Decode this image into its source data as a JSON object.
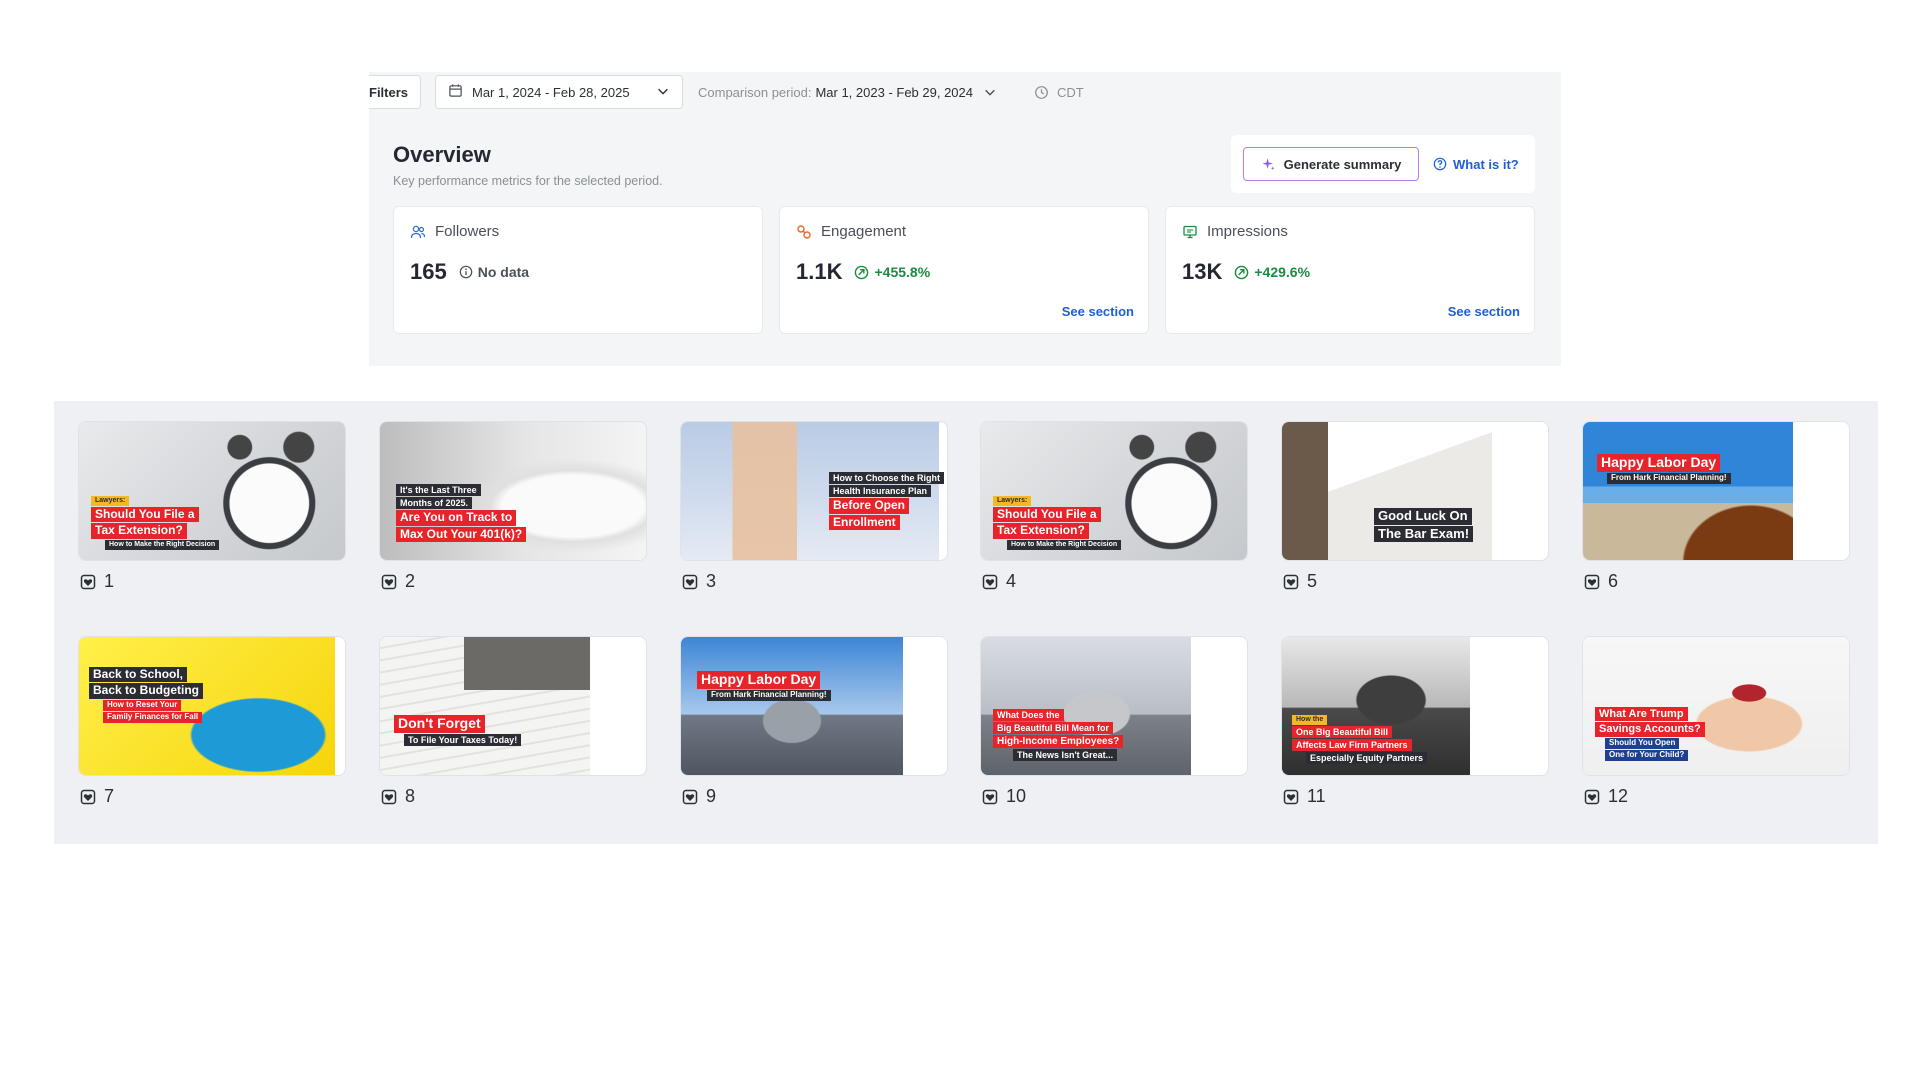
{
  "toolbar": {
    "filters_label": "Filters",
    "date_range": "Mar 1, 2024 - Feb 28, 2025",
    "comparison_label": "Comparison period:",
    "comparison_range": "Mar 1, 2023 - Feb 29, 2024",
    "timezone": "CDT"
  },
  "overview": {
    "title": "Overview",
    "subtitle": "Key performance metrics for the selected period.",
    "generate_label": "Generate summary",
    "what_label": "What is it?"
  },
  "metrics": {
    "followers": {
      "label": "Followers",
      "value": "165",
      "status": "No data",
      "accent": "#2f6fd6"
    },
    "engagement": {
      "label": "Engagement",
      "value": "1.1K",
      "delta": "+455.8%",
      "link": "See section",
      "accent": "#e8692c"
    },
    "impressions": {
      "label": "Impressions",
      "value": "13K",
      "delta": "+429.6%",
      "link": "See section",
      "accent": "#1c8a3f"
    }
  },
  "posts": [
    {
      "count": "1",
      "lines": [
        {
          "t": "Lawyers:",
          "s": "yel"
        },
        {
          "t": "Should You File a",
          "s": "red"
        },
        {
          "t": "Tax Extension?",
          "s": "red"
        },
        {
          "t": "How to Make the Right Decision",
          "s": "dark"
        }
      ]
    },
    {
      "count": "2",
      "lines": [
        {
          "t": "It's the Last Three",
          "s": "dark"
        },
        {
          "t": "Months of 2025.",
          "s": "dark"
        },
        {
          "t": "Are You on Track to",
          "s": "red"
        },
        {
          "t": "Max Out Your 401(k)?",
          "s": "red"
        }
      ]
    },
    {
      "count": "3",
      "lines": [
        {
          "t": "How to Choose the Right",
          "s": "dark"
        },
        {
          "t": "Health Insurance Plan",
          "s": "dark"
        },
        {
          "t": "Before Open",
          "s": "red"
        },
        {
          "t": "Enrollment",
          "s": "red"
        }
      ]
    },
    {
      "count": "4",
      "lines": [
        {
          "t": "Lawyers:",
          "s": "yel"
        },
        {
          "t": "Should You File a",
          "s": "red"
        },
        {
          "t": "Tax Extension?",
          "s": "red"
        },
        {
          "t": "How to Make the Right Decision",
          "s": "dark"
        }
      ]
    },
    {
      "count": "5",
      "lines": [
        {
          "t": "Good Luck On",
          "s": "dark"
        },
        {
          "t": "The Bar Exam!",
          "s": "dark"
        }
      ]
    },
    {
      "count": "6",
      "lines": [
        {
          "t": "Happy Labor Day",
          "s": "red"
        },
        {
          "t": "From Hark Financial Planning!",
          "s": "dark"
        }
      ]
    },
    {
      "count": "7",
      "lines": [
        {
          "t": "Back to School,",
          "s": "dark"
        },
        {
          "t": "Back to Budgeting",
          "s": "dark"
        },
        {
          "t": "How to Reset Your",
          "s": "red"
        },
        {
          "t": "Family Finances for Fall",
          "s": "red"
        }
      ]
    },
    {
      "count": "8",
      "lines": [
        {
          "t": "Don't Forget",
          "s": "red"
        },
        {
          "t": "To File Your Taxes Today!",
          "s": "dark"
        }
      ]
    },
    {
      "count": "9",
      "lines": [
        {
          "t": "Happy Labor Day",
          "s": "red"
        },
        {
          "t": "From Hark Financial Planning!",
          "s": "dark"
        }
      ]
    },
    {
      "count": "10",
      "lines": [
        {
          "t": "What Does the",
          "s": "red"
        },
        {
          "t": "Big Beautiful Bill Mean for",
          "s": "red"
        },
        {
          "t": "High-Income Employees?",
          "s": "red"
        },
        {
          "t": "The News Isn't Great...",
          "s": "dark"
        }
      ]
    },
    {
      "count": "11",
      "lines": [
        {
          "t": "How the",
          "s": "yel"
        },
        {
          "t": "One Big Beautiful Bill",
          "s": "red"
        },
        {
          "t": "Affects Law Firm Partners",
          "s": "red"
        },
        {
          "t": "Especially Equity Partners",
          "s": "dark"
        }
      ]
    },
    {
      "count": "12",
      "lines": [
        {
          "t": "What Are Trump",
          "s": "red"
        },
        {
          "t": "Savings Accounts?",
          "s": "red"
        },
        {
          "t": "Should You Open",
          "s": "dark"
        },
        {
          "t": "One for Your Child?",
          "s": "dark"
        }
      ]
    }
  ]
}
